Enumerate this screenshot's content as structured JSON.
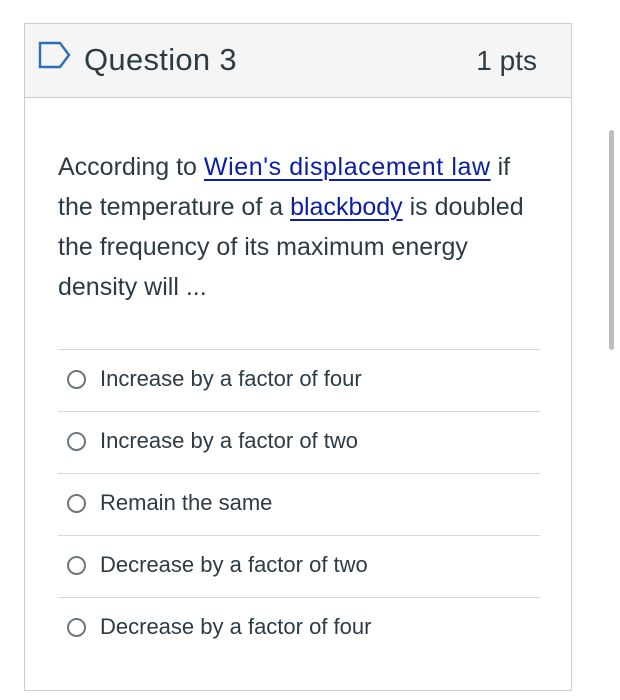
{
  "header": {
    "question_label": "Question 3",
    "points_label": "1 pts"
  },
  "question": {
    "text_part1": "According to ",
    "link1": "Wien's displacement law",
    "text_part2": " if the temperature of a ",
    "link2": "blackbody",
    "text_part3": " is doubled the frequency of its maximum energy density will ..."
  },
  "answers": [
    {
      "label": "Increase by a factor of four",
      "selected": false
    },
    {
      "label": "Increase by a factor of two",
      "selected": false
    },
    {
      "label": "Remain the same",
      "selected": false
    },
    {
      "label": "Decrease by a factor of two",
      "selected": false
    },
    {
      "label": "Decrease by a factor of four",
      "selected": false
    }
  ],
  "colors": {
    "link": "#0a1ea8",
    "flag": "#2c6fb7",
    "text": "#2d3b45",
    "header_bg": "#f5f5f5"
  },
  "icons": {
    "flag": "flag-icon",
    "radio": "radio-button-icon"
  }
}
